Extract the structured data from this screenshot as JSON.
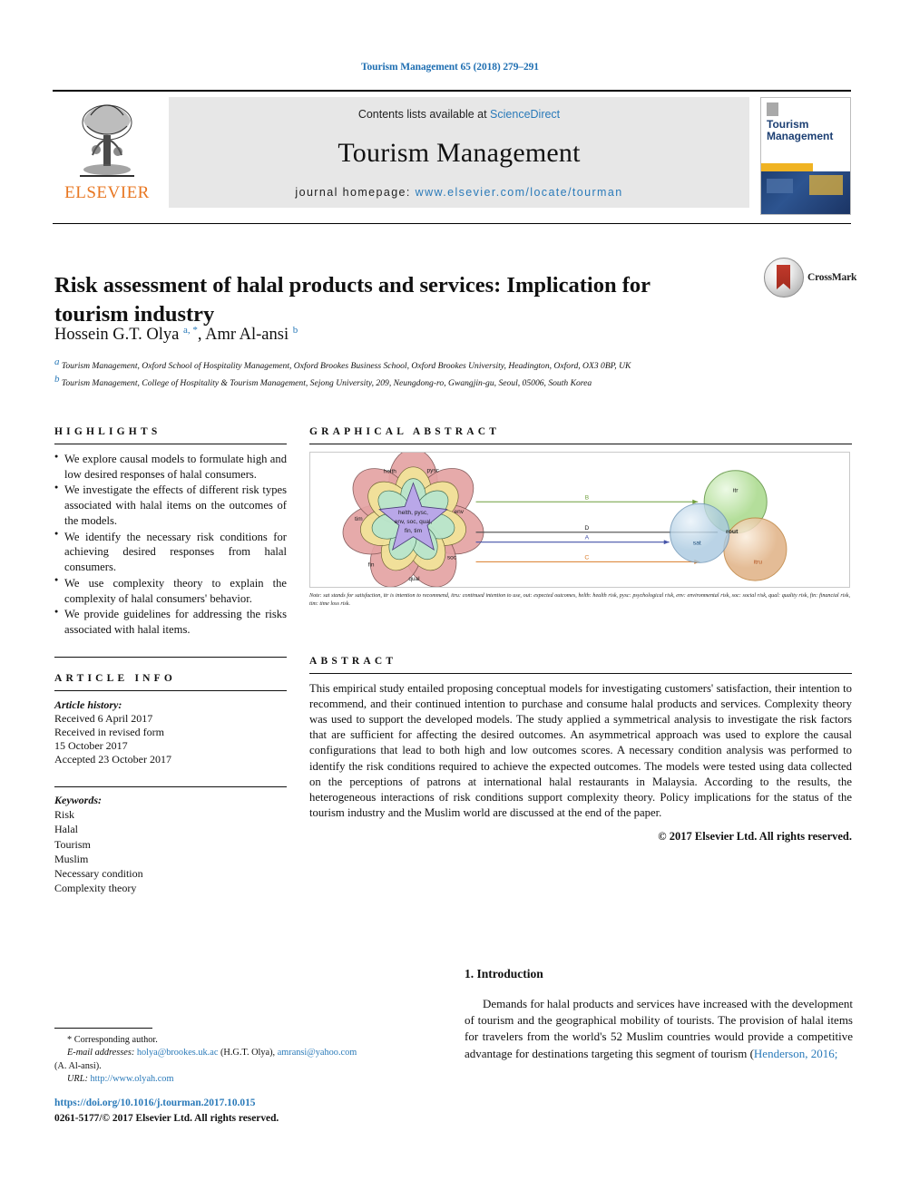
{
  "running_head": "Tourism Management 65 (2018) 279–291",
  "masthead": {
    "publisher": "ELSEVIER",
    "contents_prefix": "Contents lists available at ",
    "contents_link": "ScienceDirect",
    "journal_title": "Tourism Management",
    "homepage_prefix": "journal homepage: ",
    "homepage_url": "www.elsevier.com/locate/tourman",
    "cover_title_line1": "Tourism",
    "cover_title_line2": "Management"
  },
  "article": {
    "title": "Risk assessment of halal products and services: Implication for tourism industry",
    "authors_html": "Hossein G.T. Olya <sup>a, *</sup>, Amr Al-ansi <sup>b</sup>",
    "affiliation_a": "Tourism Management, Oxford School of Hospitality Management, Oxford Brookes Business School, Oxford Brookes University, Headington, Oxford, OX3 0BP, UK",
    "affiliation_b": "Tourism Management, College of Hospitality & Tourism Management, Sejong University, 209, Neungdong-ro, Gwangjin-gu, Seoul, 05006, South Korea",
    "crossmark_label": "CrossMark"
  },
  "highlights": {
    "heading": "HIGHLIGHTS",
    "items": [
      "We explore causal models to formulate high and low desired responses of halal consumers.",
      "We investigate the effects of different risk types associated with halal items on the outcomes of the models.",
      "We identify the necessary risk conditions for achieving desired responses from halal consumers.",
      "We use complexity theory to explain the complexity of halal consumers' behavior.",
      "We provide guidelines for addressing the risks associated with halal items."
    ]
  },
  "article_info": {
    "heading": "ARTICLE INFO",
    "history_label": "Article history:",
    "history_lines": [
      "Received 6 April 2017",
      "Received in revised form",
      "15 October 2017",
      "Accepted 23 October 2017"
    ],
    "keywords_label": "Keywords:",
    "keywords": [
      "Risk",
      "Halal",
      "Tourism",
      "Muslim",
      "Necessary condition",
      "Complexity theory"
    ]
  },
  "graphical_abstract": {
    "heading": "GRAPHICAL ABSTRACT",
    "core_label": "helth, pysc,\nenv, soc, qual,\nfin, tim",
    "petal_labels": [
      "helth",
      "pysc",
      "env",
      "soc",
      "qual",
      "fin",
      "tim"
    ],
    "path_labels": [
      "B",
      "D",
      "A",
      "C"
    ],
    "outcome_labels": [
      "itr",
      "sat",
      "itru",
      "rout"
    ],
    "note": "Note: sat stands for satisfaction, itr is intention to recommend, itru: continued intention to use, out: expected outcomes, helth: health risk, pysc: psychological risk, env: environmental risk, soc: social risk, qual: quality risk, fin: financial risk, tim: time loss risk."
  },
  "abstract": {
    "heading": "ABSTRACT",
    "text": "This empirical study entailed proposing conceptual models for investigating customers' satisfaction, their intention to recommend, and their continued intention to purchase and consume halal products and services. Complexity theory was used to support the developed models. The study applied a symmetrical analysis to investigate the risk factors that are sufficient for affecting the desired outcomes. An asymmetrical approach was used to explore the causal configurations that lead to both high and low outcomes scores. A necessary condition analysis was performed to identify the risk conditions required to achieve the expected outcomes. The models were tested using data collected on the perceptions of patrons at international halal restaurants in Malaysia. According to the results, the heterogeneous interactions of risk conditions support complexity theory. Policy implications for the status of the tourism industry and the Muslim world are discussed at the end of the paper.",
    "copyright": "© 2017 Elsevier Ltd. All rights reserved."
  },
  "introduction": {
    "heading": "1. Introduction",
    "paragraph_pre": "Demands for halal products and services have increased with the development of tourism and the geographical mobility of tourists. The provision of halal items for travelers from the world's 52 Muslim countries would provide a competitive advantage for destinations targeting this segment of tourism (",
    "citation": "Henderson, 2016;",
    "paragraph_post": ""
  },
  "footnotes": {
    "corresponding": "* Corresponding author.",
    "email_label": "E-mail addresses:",
    "email_1": "holya@brookes.uk.ac",
    "email_1_owner": "(H.G.T. Olya),",
    "email_2": "amransi@yahoo.com",
    "email_2_owner": "(A. Al-ansi).",
    "url_label": "URL:",
    "url_value": "http://www.olyah.com",
    "doi": "https://doi.org/10.1016/j.tourman.2017.10.015",
    "issn_line": "0261-5177/© 2017 Elsevier Ltd. All rights reserved."
  },
  "colors": {
    "link": "#2a7ab9",
    "elsevier_orange": "#e87722",
    "band_gray": "#e7e7e7"
  }
}
